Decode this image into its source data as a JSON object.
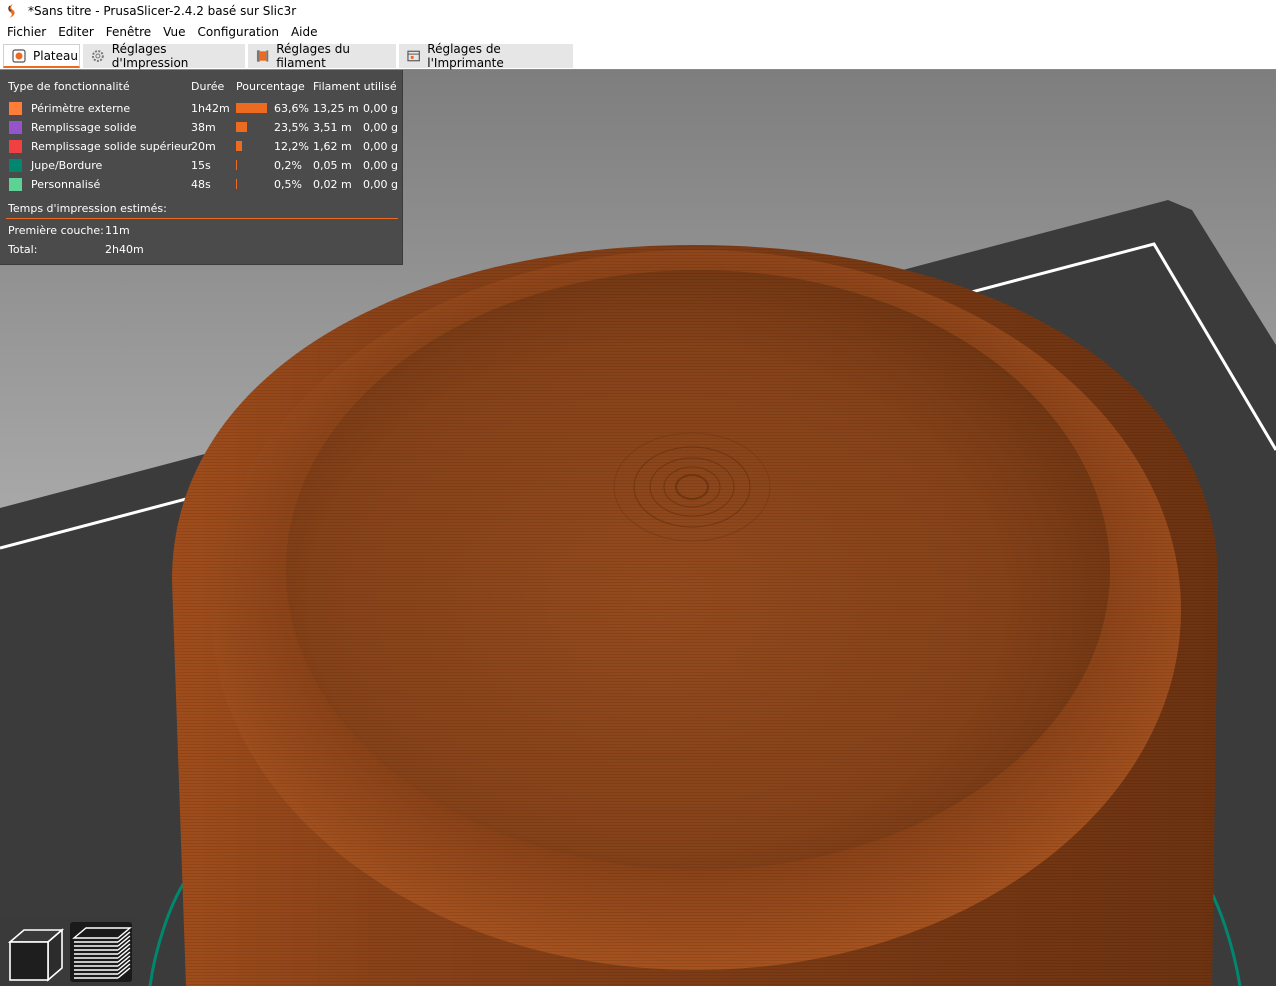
{
  "window": {
    "title": "*Sans titre - PrusaSlicer-2.4.2 basé sur Slic3r"
  },
  "menu": [
    "Fichier",
    "Editer",
    "Fenêtre",
    "Vue",
    "Configuration",
    "Aide"
  ],
  "tabs": [
    {
      "label": "Plateau",
      "icon": "plater-icon",
      "active": true
    },
    {
      "label": "Réglages d'Impression",
      "icon": "gear-icon",
      "active": false
    },
    {
      "label": "Réglages du filament",
      "icon": "filament-spool-icon",
      "active": false
    },
    {
      "label": "Réglages de l'Imprimante",
      "icon": "printer-icon",
      "active": false
    }
  ],
  "legend": {
    "headers": {
      "type": "Type de fonctionnalité",
      "duration": "Durée",
      "percent": "Pourcentage",
      "filament": "Filament utilisé"
    },
    "rows": [
      {
        "type": "Périmètre externe",
        "color": "#ff7d38",
        "duration": "1h42m",
        "percent": "63,6%",
        "share": 0.636,
        "length": "13,25 m",
        "weight": "0,00 g"
      },
      {
        "type": "Remplissage solide",
        "color": "#9654cc",
        "duration": "38m",
        "percent": "23,5%",
        "share": 0.235,
        "length": "3,51 m",
        "weight": "0,00 g"
      },
      {
        "type": "Remplissage solide supérieur",
        "color": "#f04040",
        "duration": "20m",
        "percent": "12,2%",
        "share": 0.122,
        "length": "1,62 m",
        "weight": "0,00 g"
      },
      {
        "type": "Jupe/Bordure",
        "color": "#00876e",
        "duration": "15s",
        "percent": "0,2%",
        "share": 0.002,
        "length": "0,05 m",
        "weight": "0,00 g"
      },
      {
        "type": "Personnalisé",
        "color": "#5ed194",
        "duration": "48s",
        "percent": "0,5%",
        "share": 0.005,
        "length": "0,02 m",
        "weight": "0,00 g"
      }
    ],
    "estimated_label": "Temps d'impression estimés:",
    "first_layer_label": "Première couche:",
    "first_layer_value": "11m",
    "total_label": "Total:",
    "total_value": "2h40m"
  },
  "view_buttons": [
    {
      "icon": "3d-view-cube-icon",
      "selected": false
    },
    {
      "icon": "layers-preview-icon",
      "selected": true
    }
  ],
  "colors": {
    "accent": "#ed6b21",
    "print_body": "#8a4319",
    "bed": "#3b3b3b",
    "background": "#b0b0b0"
  }
}
